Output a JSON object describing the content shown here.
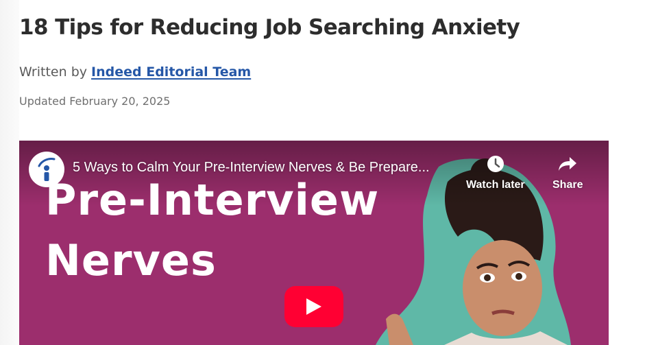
{
  "article": {
    "title": "18 Tips for Reducing Job Searching Anxiety",
    "byline_prefix": "Written by",
    "author": "Indeed Editorial Team",
    "updated": "Updated February 20, 2025"
  },
  "video": {
    "title": "5 Ways to Calm Your Pre-Interview Nerves & Be Prepare...",
    "thumbnail_line1": "Pre-Interview",
    "thumbnail_line2": "Nerves",
    "watch_later_label": "Watch later",
    "share_label": "Share",
    "channel_logo_icon": "indeed-logo-icon",
    "play_icon": "youtube-play-icon",
    "background_color": "#9c2e6d",
    "play_color": "#ff0033",
    "link_color": "#2557a7"
  }
}
